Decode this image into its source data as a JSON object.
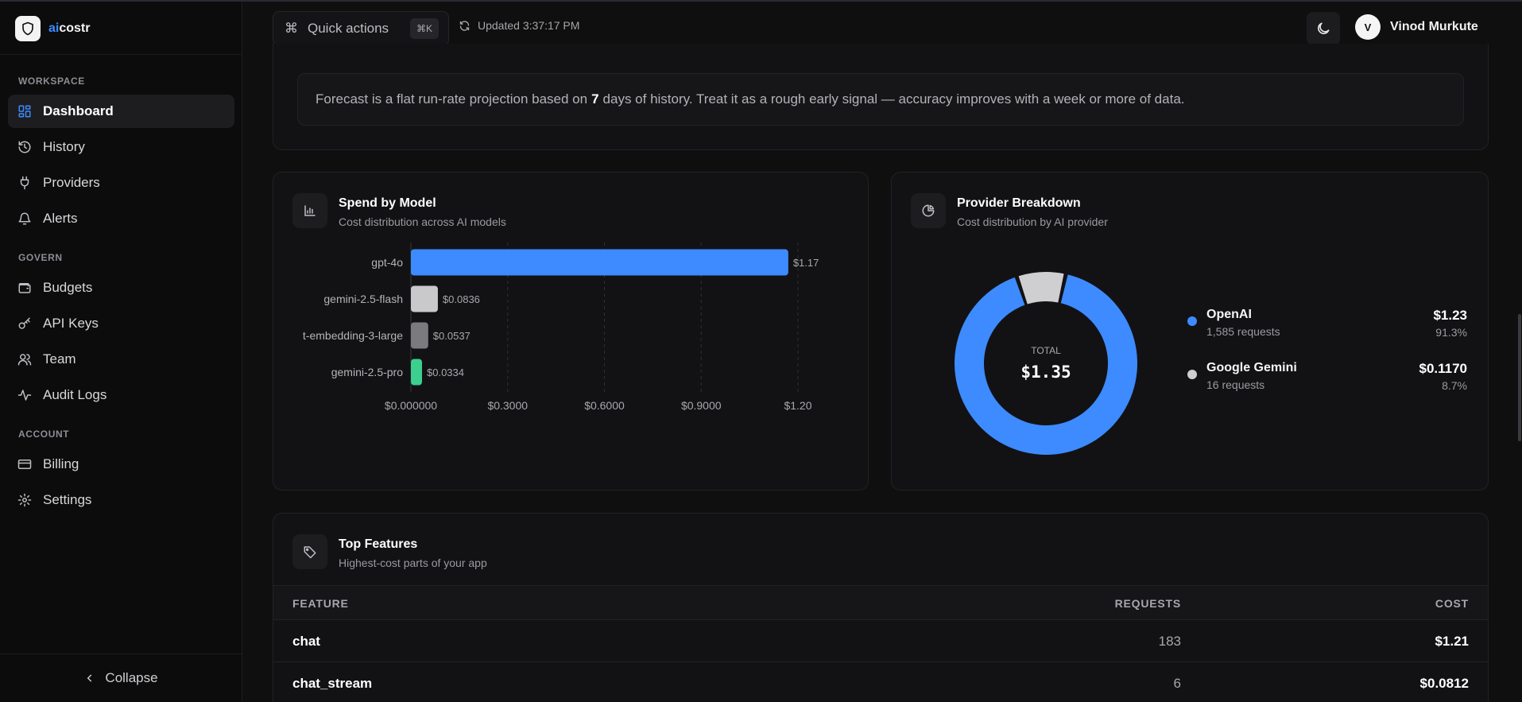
{
  "app": {
    "brand_prefix": "ai",
    "brand_suffix": "costr",
    "colors": {
      "accent": "#3d8bff",
      "background": "#0f0f10",
      "card": "#121214"
    }
  },
  "sidebar": {
    "sections": [
      {
        "title": "WORKSPACE",
        "items": [
          {
            "label": "Dashboard",
            "icon": "dashboard-icon",
            "active": true
          },
          {
            "label": "History",
            "icon": "history-icon"
          },
          {
            "label": "Providers",
            "icon": "plug-icon"
          },
          {
            "label": "Alerts",
            "icon": "bell-icon"
          }
        ]
      },
      {
        "title": "GOVERN",
        "items": [
          {
            "label": "Budgets",
            "icon": "wallet-icon"
          },
          {
            "label": "API Keys",
            "icon": "key-icon"
          },
          {
            "label": "Team",
            "icon": "users-icon"
          },
          {
            "label": "Audit Logs",
            "icon": "activity-icon"
          }
        ]
      },
      {
        "title": "ACCOUNT",
        "items": [
          {
            "label": "Billing",
            "icon": "credit-card-icon"
          },
          {
            "label": "Settings",
            "icon": "gear-icon"
          }
        ]
      }
    ],
    "collapse_label": "Collapse"
  },
  "header": {
    "quick_actions_label": "Quick actions",
    "quick_actions_shortcut": "⌘K",
    "updated_text": "Updated 3:37:17 PM",
    "user_initial": "V",
    "user_name": "Vinod Murkute"
  },
  "forecast": {
    "text_before": "Forecast is a flat run-rate projection based on",
    "days": "7",
    "text_after": "days of history. Treat it as a rough early signal — accuracy improves with a week or more of data."
  },
  "spend_by_model": {
    "title": "Spend by Model",
    "subtitle": "Cost distribution across AI models"
  },
  "provider_breakdown": {
    "title": "Provider Breakdown",
    "subtitle": "Cost distribution by AI provider",
    "total_label": "TOTAL",
    "total_value": "$1.35",
    "providers": [
      {
        "name": "OpenAI",
        "requests": "1,585 requests",
        "cost": "$1.23",
        "pct": "91.3%",
        "color": "#3d8bff"
      },
      {
        "name": "Google Gemini",
        "requests": "16 requests",
        "cost": "$0.1170",
        "pct": "8.7%",
        "color": "#cfcfd2"
      }
    ]
  },
  "top_features": {
    "title": "Top Features",
    "subtitle": "Highest-cost parts of your app",
    "columns": [
      "FEATURE",
      "REQUESTS",
      "COST"
    ],
    "rows": [
      {
        "feature": "chat",
        "requests": "183",
        "cost": "$1.21"
      },
      {
        "feature": "chat_stream",
        "requests": "6",
        "cost": "$0.0812"
      }
    ]
  },
  "chart_data": [
    {
      "type": "bar",
      "orientation": "horizontal",
      "title": "Spend by Model",
      "categories": [
        "gpt-4o",
        "gemini-2.5-flash",
        "t-embedding-3-large",
        "gemini-2.5-pro"
      ],
      "values": [
        1.17,
        0.0836,
        0.0537,
        0.0334
      ],
      "value_labels": [
        "$1.17",
        "$0.0836",
        "$0.0537",
        "$0.0334"
      ],
      "colors": [
        "#3d8bff",
        "#c9c9cc",
        "#7a7a7f",
        "#3ccf8e"
      ],
      "xlim": [
        0,
        1.2
      ],
      "x_ticks": [
        0,
        0.3,
        0.6,
        0.9,
        1.2
      ],
      "x_tick_labels": [
        "$0.000000",
        "$0.3000",
        "$0.6000",
        "$0.9000",
        "$1.20"
      ],
      "grid": "vertical dashed"
    },
    {
      "type": "pie",
      "variant": "donut",
      "title": "Provider Breakdown",
      "labels": [
        "OpenAI",
        "Google Gemini"
      ],
      "values": [
        1.23,
        0.117
      ],
      "percentages": [
        91.3,
        8.7
      ],
      "colors": [
        "#3d8bff",
        "#cfcfd2"
      ]
    }
  ]
}
